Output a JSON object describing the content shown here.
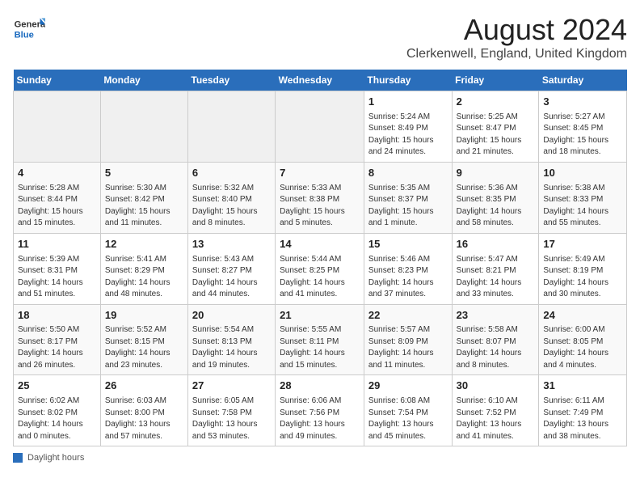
{
  "header": {
    "month_title": "August 2024",
    "location": "Clerkenwell, England, United Kingdom",
    "logo_general": "General",
    "logo_blue": "Blue"
  },
  "columns": [
    "Sunday",
    "Monday",
    "Tuesday",
    "Wednesday",
    "Thursday",
    "Friday",
    "Saturday"
  ],
  "weeks": [
    [
      {
        "day": "",
        "info": ""
      },
      {
        "day": "",
        "info": ""
      },
      {
        "day": "",
        "info": ""
      },
      {
        "day": "",
        "info": ""
      },
      {
        "day": "1",
        "info": "Sunrise: 5:24 AM\nSunset: 8:49 PM\nDaylight: 15 hours and 24 minutes."
      },
      {
        "day": "2",
        "info": "Sunrise: 5:25 AM\nSunset: 8:47 PM\nDaylight: 15 hours and 21 minutes."
      },
      {
        "day": "3",
        "info": "Sunrise: 5:27 AM\nSunset: 8:45 PM\nDaylight: 15 hours and 18 minutes."
      }
    ],
    [
      {
        "day": "4",
        "info": "Sunrise: 5:28 AM\nSunset: 8:44 PM\nDaylight: 15 hours and 15 minutes."
      },
      {
        "day": "5",
        "info": "Sunrise: 5:30 AM\nSunset: 8:42 PM\nDaylight: 15 hours and 11 minutes."
      },
      {
        "day": "6",
        "info": "Sunrise: 5:32 AM\nSunset: 8:40 PM\nDaylight: 15 hours and 8 minutes."
      },
      {
        "day": "7",
        "info": "Sunrise: 5:33 AM\nSunset: 8:38 PM\nDaylight: 15 hours and 5 minutes."
      },
      {
        "day": "8",
        "info": "Sunrise: 5:35 AM\nSunset: 8:37 PM\nDaylight: 15 hours and 1 minute."
      },
      {
        "day": "9",
        "info": "Sunrise: 5:36 AM\nSunset: 8:35 PM\nDaylight: 14 hours and 58 minutes."
      },
      {
        "day": "10",
        "info": "Sunrise: 5:38 AM\nSunset: 8:33 PM\nDaylight: 14 hours and 55 minutes."
      }
    ],
    [
      {
        "day": "11",
        "info": "Sunrise: 5:39 AM\nSunset: 8:31 PM\nDaylight: 14 hours and 51 minutes."
      },
      {
        "day": "12",
        "info": "Sunrise: 5:41 AM\nSunset: 8:29 PM\nDaylight: 14 hours and 48 minutes."
      },
      {
        "day": "13",
        "info": "Sunrise: 5:43 AM\nSunset: 8:27 PM\nDaylight: 14 hours and 44 minutes."
      },
      {
        "day": "14",
        "info": "Sunrise: 5:44 AM\nSunset: 8:25 PM\nDaylight: 14 hours and 41 minutes."
      },
      {
        "day": "15",
        "info": "Sunrise: 5:46 AM\nSunset: 8:23 PM\nDaylight: 14 hours and 37 minutes."
      },
      {
        "day": "16",
        "info": "Sunrise: 5:47 AM\nSunset: 8:21 PM\nDaylight: 14 hours and 33 minutes."
      },
      {
        "day": "17",
        "info": "Sunrise: 5:49 AM\nSunset: 8:19 PM\nDaylight: 14 hours and 30 minutes."
      }
    ],
    [
      {
        "day": "18",
        "info": "Sunrise: 5:50 AM\nSunset: 8:17 PM\nDaylight: 14 hours and 26 minutes."
      },
      {
        "day": "19",
        "info": "Sunrise: 5:52 AM\nSunset: 8:15 PM\nDaylight: 14 hours and 23 minutes."
      },
      {
        "day": "20",
        "info": "Sunrise: 5:54 AM\nSunset: 8:13 PM\nDaylight: 14 hours and 19 minutes."
      },
      {
        "day": "21",
        "info": "Sunrise: 5:55 AM\nSunset: 8:11 PM\nDaylight: 14 hours and 15 minutes."
      },
      {
        "day": "22",
        "info": "Sunrise: 5:57 AM\nSunset: 8:09 PM\nDaylight: 14 hours and 11 minutes."
      },
      {
        "day": "23",
        "info": "Sunrise: 5:58 AM\nSunset: 8:07 PM\nDaylight: 14 hours and 8 minutes."
      },
      {
        "day": "24",
        "info": "Sunrise: 6:00 AM\nSunset: 8:05 PM\nDaylight: 14 hours and 4 minutes."
      }
    ],
    [
      {
        "day": "25",
        "info": "Sunrise: 6:02 AM\nSunset: 8:02 PM\nDaylight: 14 hours and 0 minutes."
      },
      {
        "day": "26",
        "info": "Sunrise: 6:03 AM\nSunset: 8:00 PM\nDaylight: 13 hours and 57 minutes."
      },
      {
        "day": "27",
        "info": "Sunrise: 6:05 AM\nSunset: 7:58 PM\nDaylight: 13 hours and 53 minutes."
      },
      {
        "day": "28",
        "info": "Sunrise: 6:06 AM\nSunset: 7:56 PM\nDaylight: 13 hours and 49 minutes."
      },
      {
        "day": "29",
        "info": "Sunrise: 6:08 AM\nSunset: 7:54 PM\nDaylight: 13 hours and 45 minutes."
      },
      {
        "day": "30",
        "info": "Sunrise: 6:10 AM\nSunset: 7:52 PM\nDaylight: 13 hours and 41 minutes."
      },
      {
        "day": "31",
        "info": "Sunrise: 6:11 AM\nSunset: 7:49 PM\nDaylight: 13 hours and 38 minutes."
      }
    ]
  ],
  "footer": {
    "daylight_label": "Daylight hours"
  }
}
